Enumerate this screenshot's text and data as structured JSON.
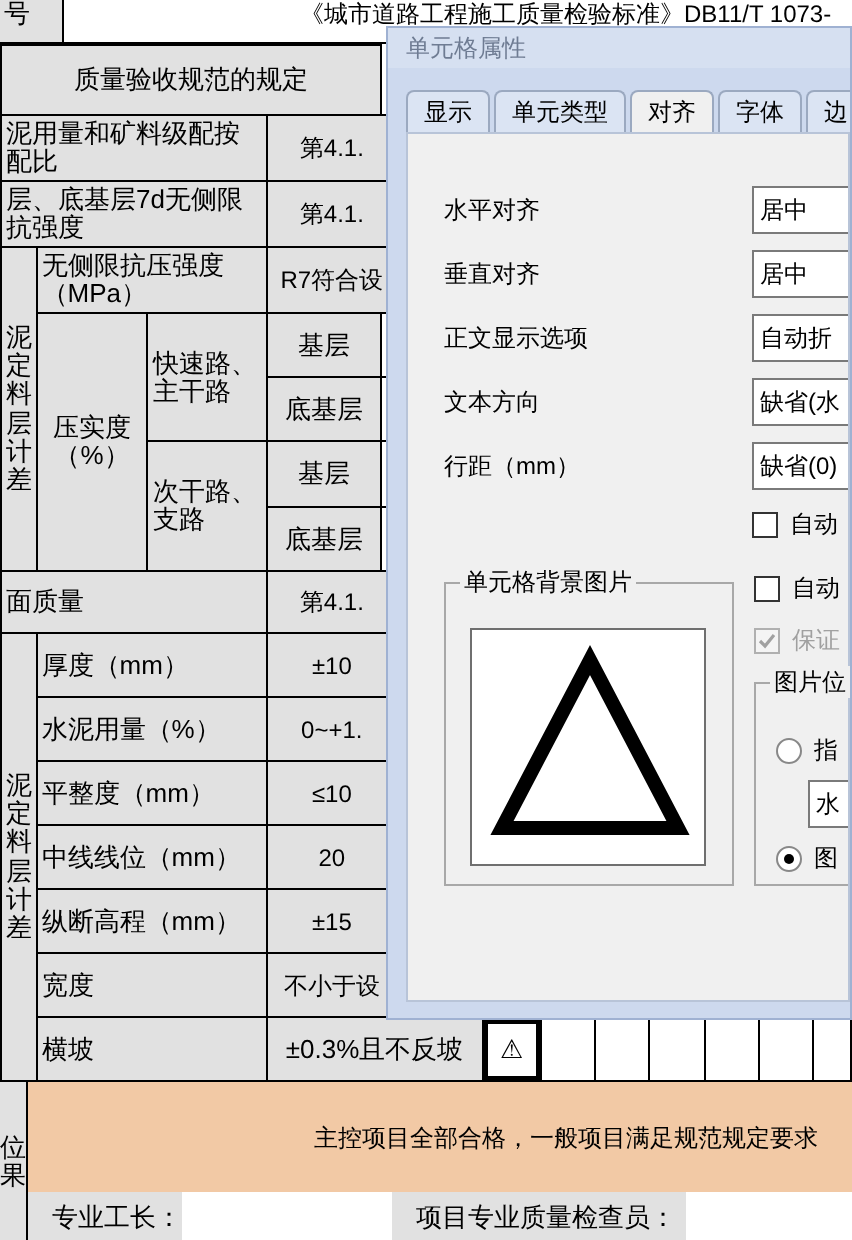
{
  "sheet": {
    "header": {
      "number_label": "号",
      "title": "《城市道路工程施工质量检验标准》DB11/T 1073-"
    },
    "rows": [
      [
        {
          "kind": "heading",
          "text": "质量验收规范的规定",
          "colspan": 4,
          "selected": false
        }
      ],
      [
        {
          "kind": "label",
          "text": "泥用量和矿料级配按配比",
          "colspan": 3,
          "selected": false
        },
        {
          "kind": "value",
          "text": "第4.1.",
          "colspan": 2,
          "selected": false
        }
      ],
      [
        {
          "kind": "label",
          "text": "层、底基层7d无侧限抗强度",
          "colspan": 3,
          "selected": false
        },
        {
          "kind": "value",
          "text": "第4.1.",
          "colspan": 2,
          "selected": false
        }
      ],
      [
        {
          "kind": "vertical",
          "text": "泥定料层计差",
          "rowspan": 5,
          "selected": false
        },
        {
          "kind": "label",
          "text": "无侧限抗压强度（MPa）",
          "colspan": 2,
          "selected": false
        },
        {
          "kind": "value",
          "text": "R7符合设",
          "colspan": 2,
          "selected": false
        }
      ],
      [
        {
          "kind": "heading",
          "text": "压实度（%）",
          "rowspan": 4,
          "selected": false
        },
        {
          "kind": "label",
          "text": "快速路、主干路",
          "rowspan": 2,
          "selected": false
        },
        {
          "kind": "value",
          "text": "基层",
          "selected": false
        },
        {
          "kind": "blank",
          "selected": false
        }
      ],
      [
        {
          "kind": "value",
          "text": "底基层",
          "selected": false
        },
        {
          "kind": "blank",
          "selected": false
        }
      ],
      [
        {
          "kind": "label",
          "text": "次干路、支路",
          "rowspan": 2,
          "selected": false
        },
        {
          "kind": "value",
          "text": "基层",
          "selected": false
        },
        {
          "kind": "blank",
          "selected": false
        }
      ],
      [
        {
          "kind": "value",
          "text": "底基层",
          "selected": false
        },
        {
          "kind": "blank",
          "selected": false
        }
      ],
      [
        {
          "kind": "label",
          "text": "面质量",
          "colspan": 3,
          "selected": false
        },
        {
          "kind": "value",
          "text": "第4.1.",
          "colspan": 2,
          "selected": false
        }
      ],
      [
        {
          "kind": "vertical",
          "text": "泥定料层计差",
          "rowspan": 7,
          "selected": false
        },
        {
          "kind": "label",
          "text": "厚度（mm）",
          "colspan": 2,
          "selected": false
        },
        {
          "kind": "value",
          "text": "±10",
          "colspan": 2,
          "selected": false
        }
      ],
      [
        {
          "kind": "label",
          "text": "水泥用量（%）",
          "colspan": 2,
          "selected": false
        },
        {
          "kind": "value",
          "text": "0~+1.",
          "colspan": 2,
          "selected": false
        }
      ],
      [
        {
          "kind": "label",
          "text": "平整度（mm）",
          "colspan": 2,
          "selected": false
        },
        {
          "kind": "value",
          "text": "≤10",
          "colspan": 2,
          "selected": false
        }
      ],
      [
        {
          "kind": "label",
          "text": "中线线位（mm）",
          "colspan": 2,
          "selected": false
        },
        {
          "kind": "value",
          "text": "20",
          "colspan": 2,
          "selected": false
        }
      ],
      [
        {
          "kind": "label",
          "text": "纵断高程（mm）",
          "colspan": 2,
          "selected": false
        },
        {
          "kind": "value",
          "text": "±15",
          "colspan": 2,
          "selected": false
        }
      ],
      [
        {
          "kind": "label",
          "text": "宽度",
          "colspan": 2,
          "selected": false
        },
        {
          "kind": "value",
          "text": "不小于设",
          "colspan": 2,
          "selected": false
        }
      ],
      [
        {
          "kind": "label",
          "text": "横坡",
          "colspan": 2,
          "selected": false
        },
        {
          "kind": "value",
          "text": "±0.3%且不反坡",
          "colspan": 2,
          "selected": false
        },
        {
          "kind": "mark",
          "text": "⚠",
          "selected": true
        },
        {
          "kind": "blank",
          "selected": false
        },
        {
          "kind": "blank",
          "selected": false
        },
        {
          "kind": "blank",
          "selected": false
        },
        {
          "kind": "blank",
          "selected": false
        },
        {
          "kind": "blank",
          "selected": false
        },
        {
          "kind": "blank",
          "selected": false
        }
      ]
    ],
    "result": {
      "label": "位果",
      "text": "主控项目全部合格，一般项目满足规范规定要求",
      "signers": [
        {
          "label": "专业工长："
        },
        {
          "label": "项目专业质量检查员："
        }
      ]
    }
  },
  "dialog": {
    "title": "单元格属性",
    "tabs": [
      {
        "label": "显示",
        "selected": false
      },
      {
        "label": "单元类型",
        "selected": false
      },
      {
        "label": "对齐",
        "selected": true
      },
      {
        "label": "字体",
        "selected": false
      },
      {
        "label": "边",
        "selected": false
      }
    ],
    "fields": [
      {
        "label": "水平对齐",
        "value": "居中"
      },
      {
        "label": "垂直对齐",
        "value": "居中"
      },
      {
        "label": "正文显示选项",
        "value": "自动折"
      },
      {
        "label": "文本方向",
        "value": "缺省(水"
      },
      {
        "label": "行距（mm）",
        "value": "缺省(0)"
      }
    ],
    "checkboxes": [
      {
        "label": "自动",
        "checked": false,
        "disabled": false
      },
      {
        "label": "自动",
        "checked": false,
        "disabled": false
      },
      {
        "label": "保证",
        "checked": true,
        "disabled": true
      }
    ],
    "background_group": {
      "title": "单元格背景图片"
    },
    "position_group": {
      "title": "图片位",
      "options": [
        {
          "kind": "radio",
          "label": "指",
          "selected": false
        },
        {
          "kind": "dropdown",
          "value": "水"
        },
        {
          "kind": "radio",
          "label": "图",
          "selected": true
        }
      ]
    }
  }
}
